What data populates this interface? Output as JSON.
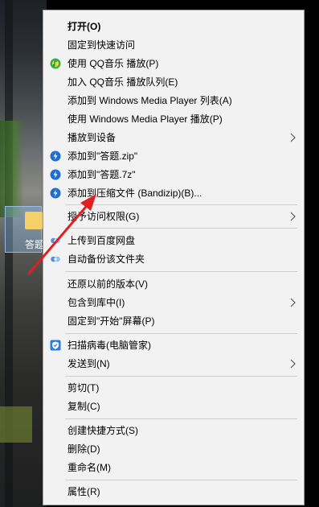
{
  "desktop": {
    "icon_label": "答题"
  },
  "menu": {
    "items": [
      {
        "label": "打开(O)"
      },
      {
        "label": "固定到快速访问"
      },
      {
        "label": "使用 QQ音乐 播放(P)"
      },
      {
        "label": "加入 QQ音乐 播放队列(E)"
      },
      {
        "label": "添加到 Windows Media Player 列表(A)"
      },
      {
        "label": "使用 Windows Media Player 播放(P)"
      },
      {
        "label": "播放到设备"
      },
      {
        "label": "添加到\"答题.zip\""
      },
      {
        "label": "添加到\"答题.7z\""
      },
      {
        "label": "添加到压缩文件 (Bandizip)(B)..."
      },
      {
        "label": "授予访问权限(G)"
      },
      {
        "label": "上传到百度网盘"
      },
      {
        "label": "自动备份该文件夹"
      },
      {
        "label": "还原以前的版本(V)"
      },
      {
        "label": "包含到库中(I)"
      },
      {
        "label": "固定到\"开始\"屏幕(P)"
      },
      {
        "label": "扫描病毒(电脑管家)"
      },
      {
        "label": "发送到(N)"
      },
      {
        "label": "剪切(T)"
      },
      {
        "label": "复制(C)"
      },
      {
        "label": "创建快捷方式(S)"
      },
      {
        "label": "删除(D)"
      },
      {
        "label": "重命名(M)"
      },
      {
        "label": "属性(R)"
      }
    ]
  },
  "colors": {
    "menu_bg": "#f2f2f2",
    "bandizip_icon": "#1f6fd1",
    "qqmusic_icon": "#2fb34a",
    "baidu_icon": "#5b8fd8",
    "guanjia_icon": "#2a7ce0",
    "annotation_arrow": "#e02020"
  },
  "icons": {
    "qqmusic": "qq-music-icon",
    "bandizip": "bandizip-icon",
    "baidu": "baidu-netdisk-icon",
    "backup": "auto-backup-icon",
    "guanjia": "pc-manager-shield-icon",
    "submenu": "chevron-right-icon"
  }
}
